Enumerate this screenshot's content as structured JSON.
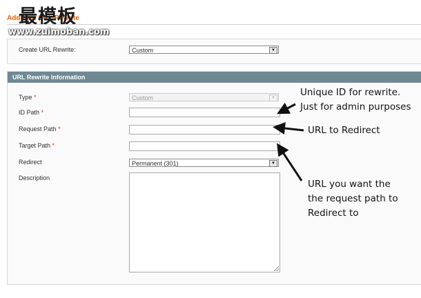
{
  "header": {
    "title": "Add New URL Rewrite",
    "watermark_cn": "最模板",
    "watermark_url": "www.zuimoban.com"
  },
  "create_section": {
    "label": "Create URL Rewrite:",
    "value": "Custom"
  },
  "info_section": {
    "heading": "URL Rewrite Information",
    "fields": {
      "type": {
        "label": "Type",
        "value": "Custom"
      },
      "id_path": {
        "label": "ID Path",
        "value": ""
      },
      "request_path": {
        "label": "Request Path",
        "value": ""
      },
      "target_path": {
        "label": "Target Path",
        "value": ""
      },
      "redirect": {
        "label": "Redirect",
        "value": "Permanent (301)"
      },
      "description": {
        "label": "Description",
        "value": ""
      }
    },
    "required_mark": "*"
  },
  "annotations": {
    "id_path_line1": "Unique ID for rewrite.",
    "id_path_line2": "Just for admin purposes",
    "request_path": "URL to Redirect",
    "target_line1": "URL you want the",
    "target_line2": "the request path to",
    "target_line3": "Redirect to"
  },
  "colors": {
    "title_orange": "#eb5e00",
    "section_header": "#6f8992",
    "required_red": "#eb2e0b"
  },
  "icons": [
    "dropdown-arrow-icon",
    "resize-grip-icon",
    "annotation-arrow"
  ]
}
